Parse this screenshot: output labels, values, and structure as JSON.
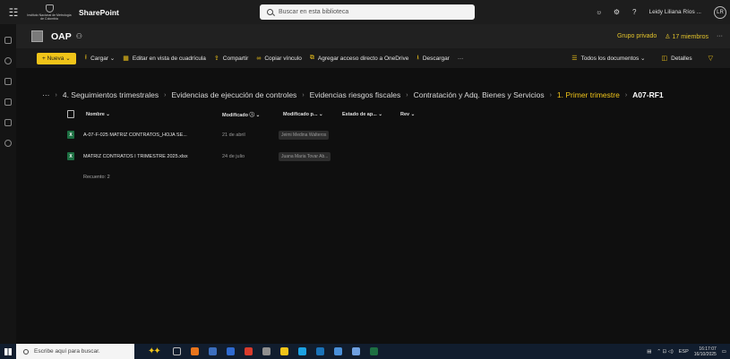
{
  "suitebar": {
    "waffle": "☷",
    "org_logo_text": "Instituto Nacional de Metrología de Colombia",
    "app_name": "SharePoint",
    "search_placeholder": "Buscar en esta biblioteca",
    "icons": [
      "people-icon",
      "settings-icon",
      "help-icon"
    ],
    "user_name": "Leidy Liliana Ríos ...",
    "user_initials": "LR"
  },
  "site": {
    "title": "OAP",
    "privacy": "Grupo privado",
    "members": "17 miembros",
    "more": "···"
  },
  "commandbar": {
    "new": "+ Nueva ⌄",
    "upload": "Cargar ⌄",
    "grid_edit": "Editar en vista de cuadrícula",
    "share": "Compartir",
    "copy_link": "Copiar vínculo",
    "shortcut": "Agregar acceso directo a OneDrive",
    "download": "Descargar",
    "more": "···",
    "view": "Todos los documentos ⌄",
    "details": "Detalles"
  },
  "breadcrumb": {
    "overflow": "···",
    "items": [
      "4. Seguimientos trimestrales",
      "Evidencias de ejecución de controles",
      "Evidencias riesgos fiscales",
      "Contratación y Adq. Bienes y Servicios",
      "1. Primer trimestre",
      "A07-RF1"
    ]
  },
  "list": {
    "columns": {
      "name": "Nombre ⌄",
      "modified": "Modificado ⓘ ⌄",
      "modified_by": "Modificado p... ⌄",
      "status": "Estado de ap... ⌄",
      "rev": "Rev ⌄"
    },
    "rows": [
      {
        "name": "A-07-F-025 MATRIZ CONTRATOS_HOJA SE...",
        "modified": "21 de abril",
        "modified_by": "Jeimi Medina Walteros"
      },
      {
        "name": "MATRIZ CONTRATOS I TRIMESTRE 2025.xlsx",
        "modified": "24 de julio",
        "modified_by": "Juana Maria Tovar Ab..."
      }
    ],
    "count": "Recuento: 2"
  },
  "taskbar": {
    "search_placeholder": "Escribe aquí para buscar.",
    "lang": "ESP",
    "time": "16:17:07",
    "date": "16/10/2025"
  }
}
